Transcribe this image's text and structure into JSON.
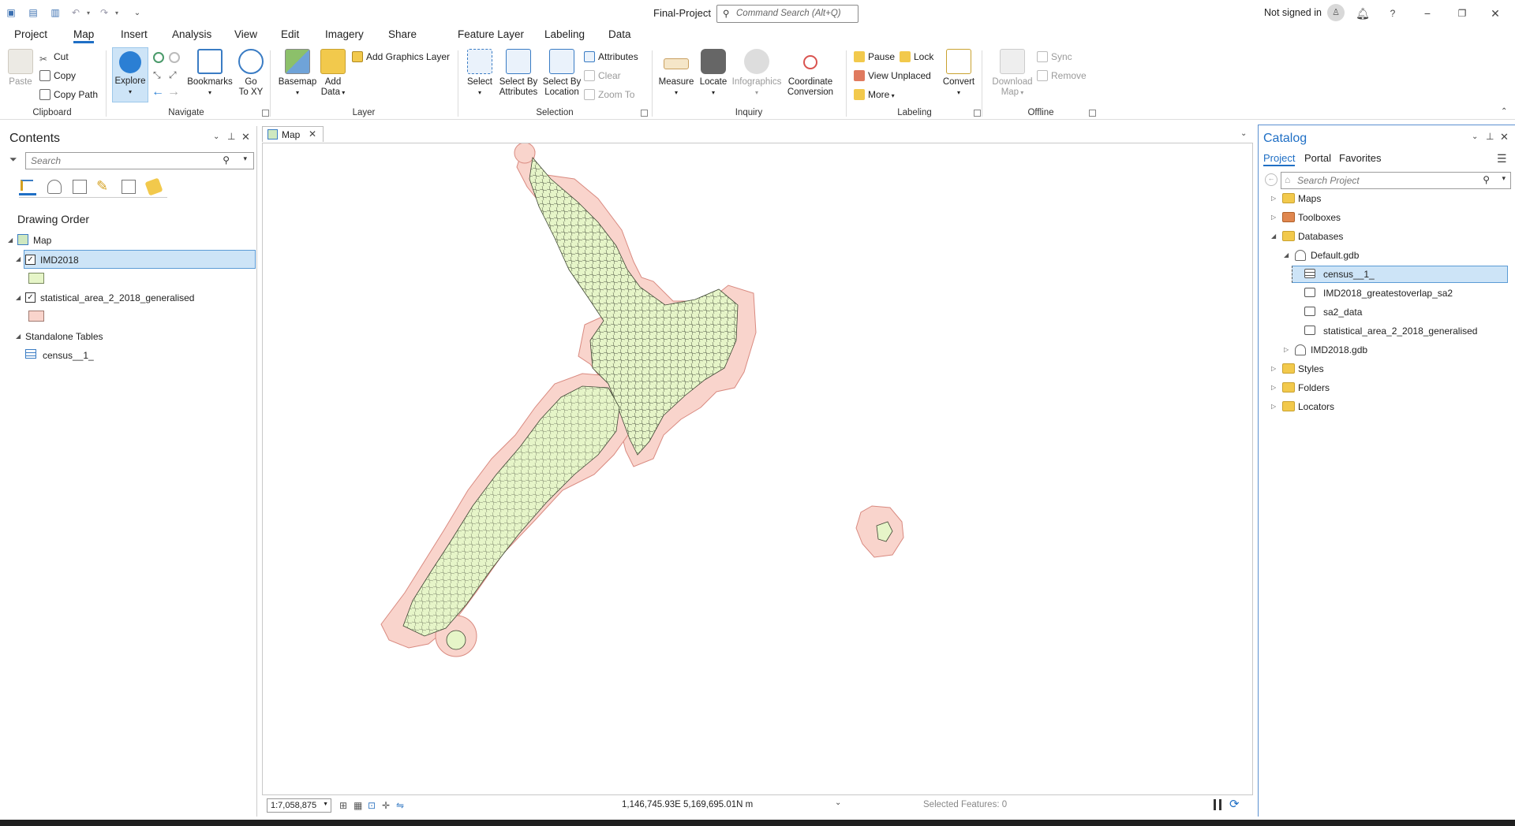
{
  "window": {
    "title": "Final-Project",
    "command_search_placeholder": "Command Search (Alt+Q)",
    "signin": "Not signed in"
  },
  "tabs": [
    "Project",
    "Map",
    "Insert",
    "Analysis",
    "View",
    "Edit",
    "Imagery",
    "Share",
    "Feature Layer",
    "Labeling",
    "Data"
  ],
  "active_tab": "Map",
  "ribbon": {
    "clipboard": {
      "label": "Clipboard",
      "paste": "Paste",
      "cut": "Cut",
      "copy": "Copy",
      "copy_path": "Copy Path"
    },
    "navigate": {
      "label": "Navigate",
      "explore": "Explore",
      "bookmarks": "Bookmarks",
      "goto_xy_1": "Go",
      "goto_xy_2": "To XY"
    },
    "layer": {
      "label": "Layer",
      "basemap": "Basemap",
      "add_data_1": "Add",
      "add_data_2": "Data",
      "add_graphics": "Add Graphics Layer"
    },
    "selection": {
      "label": "Selection",
      "select": "Select",
      "select_by_attr_1": "Select By",
      "select_by_attr_2": "Attributes",
      "select_by_loc_1": "Select By",
      "select_by_loc_2": "Location",
      "attributes": "Attributes",
      "clear": "Clear",
      "zoom_to": "Zoom To"
    },
    "inquiry": {
      "label": "Inquiry",
      "measure": "Measure",
      "locate": "Locate",
      "infographics": "Infographics",
      "coord_1": "Coordinate",
      "coord_2": "Conversion"
    },
    "labeling": {
      "label": "Labeling",
      "pause": "Pause",
      "lock": "Lock",
      "view_unplaced": "View Unplaced",
      "more": "More",
      "convert": "Convert"
    },
    "offline": {
      "label": "Offline",
      "download_1": "Download",
      "download_2": "Map",
      "sync": "Sync",
      "remove": "Remove"
    }
  },
  "contents": {
    "title": "Contents",
    "search_placeholder": "Search",
    "drawing_order": "Drawing Order",
    "map": "Map",
    "layer1": "IMD2018",
    "layer2": "statistical_area_2_2018_generalised",
    "standalone": "Standalone Tables",
    "table1": "census__1_",
    "layer1_color": "#e6f5c8",
    "layer2_color": "#f9d4cc"
  },
  "map": {
    "tab": "Map",
    "scale": "1:7,058,875",
    "coords": "1,146,745.93E 5,169,695.01N m",
    "selected": "Selected Features: 0"
  },
  "catalog": {
    "title": "Catalog",
    "tabs": [
      "Project",
      "Portal",
      "Favorites"
    ],
    "search_placeholder": "Search Project",
    "items": {
      "maps": "Maps",
      "toolboxes": "Toolboxes",
      "databases": "Databases",
      "default_gdb": "Default.gdb",
      "census": "census__1_",
      "imd_overlap": "IMD2018_greatestoverlap_sa2",
      "sa2_data": "sa2_data",
      "sa2_gen": "statistical_area_2_2018_generalised",
      "imd_gdb": "IMD2018.gdb",
      "styles": "Styles",
      "folders": "Folders",
      "locators": "Locators"
    }
  }
}
